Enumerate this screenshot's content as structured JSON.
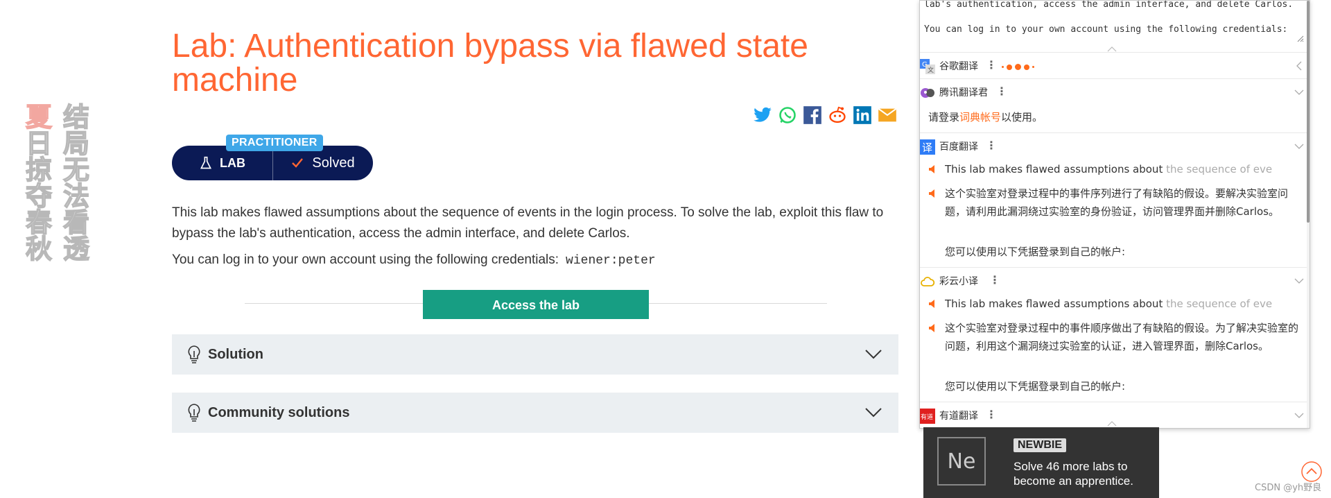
{
  "poem": {
    "right_column": [
      "结",
      "局",
      "无",
      "法",
      "看",
      "透"
    ],
    "left_column": [
      "夏",
      "日",
      "掠",
      "夺",
      "春",
      "秋"
    ]
  },
  "lab": {
    "title": "Lab: Authentication bypass via flawed state machine",
    "level_badge": "PRACTITIONER",
    "lab_label": "LAB",
    "status": "Solved",
    "description": "This lab makes flawed assumptions about the sequence of events in the login process. To solve the lab, exploit this flaw to bypass the lab's authentication, access the admin interface, and delete Carlos.",
    "credentials_label": "You can log in to your own account using the following credentials:",
    "credentials_value": "wiener:peter",
    "access_button": "Access the lab",
    "accordions": [
      "Solution",
      "Community solutions"
    ],
    "share_icons": [
      "twitter-icon",
      "whatsapp-icon",
      "facebook-icon",
      "reddit-icon",
      "linkedin-icon",
      "email-icon"
    ]
  },
  "translator": {
    "source_line1": "lab's authentication, access the admin interface, and delete Carlos.",
    "source_line2": "You can log in to your own account using the following credentials:",
    "engines": {
      "google": {
        "name": "谷歌翻译"
      },
      "tencent": {
        "name": "腾讯翻译君",
        "login_prefix": "请登录",
        "login_link": "词典帐号",
        "login_suffix": "以使用。"
      },
      "baidu": {
        "name": "百度翻译",
        "en_visible": "This lab makes flawed assumptions about ",
        "en_fade": "the sequence of eve",
        "zh": "这个实验室对登录过程中的事件序列进行了有缺陷的假设。要解决实验室问题，请利用此漏洞绕过实验室的身份验证，访问管理界面并删除Carlos。",
        "zh2": "您可以使用以下凭据登录到自己的帐户:"
      },
      "caiyun": {
        "name": "彩云小译",
        "en_visible": "This lab makes flawed assumptions about ",
        "en_fade": "the sequence of eve",
        "zh": "这个实验室对登录过程中的事件顺序做出了有缺陷的假设。为了解决实验室的问题，利用这个漏洞绕过实验室的认证，进入管理界面，删除Carlos。",
        "zh2": "您可以使用以下凭据登录到自己的帐户:"
      },
      "youdao": {
        "name": "有道翻译"
      }
    }
  },
  "newbie": {
    "tile": "Ne",
    "tag": "NEWBIE",
    "message": "Solve 46 more labs to become an apprentice."
  },
  "watermark": "CSDN @yh野良"
}
